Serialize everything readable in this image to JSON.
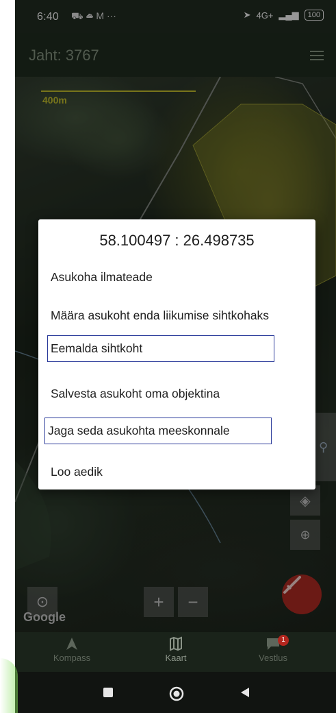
{
  "status_bar": {
    "time": "6:40",
    "icons": "⛟ ☁ M ···",
    "network": "4G+",
    "battery": "100"
  },
  "app_bar": {
    "title": "Jaht: 3767"
  },
  "map": {
    "scale_label": "400m",
    "google_label": "Google"
  },
  "dialog": {
    "coordinates": "58.100497 : 26.498735",
    "options": [
      {
        "label": "Asukoha ilmateade"
      },
      {
        "label": "Määra asukoht enda liikumise sihtkohaks"
      },
      {
        "label": "Eemalda sihtkoht"
      },
      {
        "label": "Salvesta asukoht oma objektina"
      },
      {
        "label": "Jaga seda asukohta meeskonnale"
      },
      {
        "label": "Loo aedik"
      }
    ]
  },
  "bottom_nav": {
    "items": [
      {
        "label": "Kompass",
        "icon": "compass-arrow-icon"
      },
      {
        "label": "Kaart",
        "icon": "map-icon"
      },
      {
        "label": "Vestlus",
        "icon": "chat-icon",
        "badge": "1"
      }
    ],
    "active": "Kaart"
  },
  "colors": {
    "app_bar": "#1e2a1e",
    "scale_bar": "#b8b42a",
    "fab": "#a52821",
    "highlight_border": "#2a3a9a"
  }
}
